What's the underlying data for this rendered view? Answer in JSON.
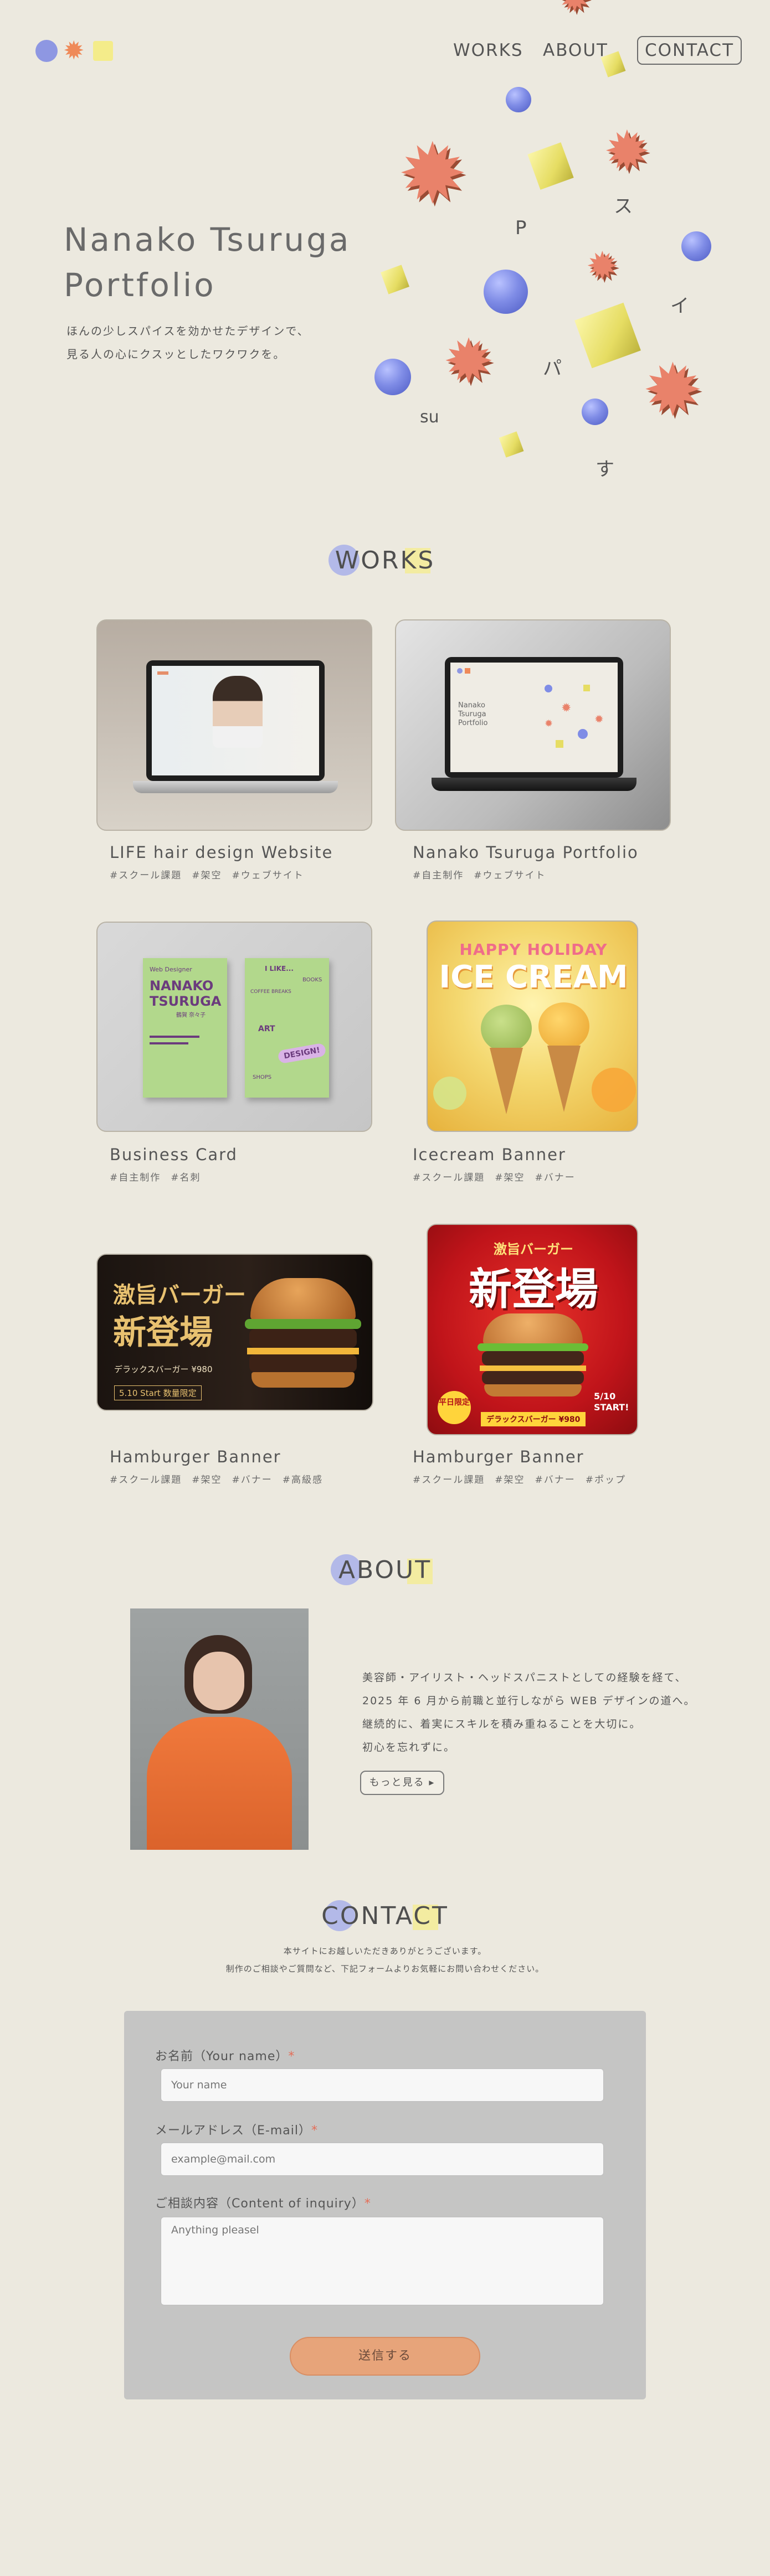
{
  "nav": {
    "works": "WORKS",
    "about": "ABOUT",
    "contact": "CONTACT"
  },
  "hero": {
    "title_line1": "Nanako Tsuruga",
    "title_line2": "Portfolio",
    "sub_line1": "ほんの少しスパイスを効かせたデザインで、",
    "sub_line2": "見る人の心にクスッとしたワクワクを。",
    "floating_letters": [
      "P",
      "ス",
      "イ",
      "パ",
      "su",
      "す"
    ]
  },
  "works": {
    "heading": "WORKS",
    "items": [
      {
        "title": "LIFE hair design Website",
        "tags": [
          "#スクール課題",
          "#架空",
          "#ウェブサイト"
        ]
      },
      {
        "title": "Nanako Tsuruga Portfolio",
        "tags": [
          "#自主制作",
          "#ウェブサイト"
        ]
      },
      {
        "title": "Business Card",
        "tags": [
          "#自主制作",
          "#名刺"
        ]
      },
      {
        "title": "Icecream Banner",
        "tags": [
          "#スクール課題",
          "#架空",
          "#バナー"
        ]
      },
      {
        "title": "Hamburger Banner",
        "tags": [
          "#スクール課題",
          "#架空",
          "#バナー",
          "#高級感"
        ]
      },
      {
        "title": "Hamburger Banner",
        "tags": [
          "#スクール課題",
          "#架空",
          "#バナー",
          "#ポップ"
        ]
      }
    ],
    "thumb_texts": {
      "card_name": "NANAKO TSURUGA",
      "card_kana": "鶴賀 奈々子",
      "card_label": "Web Designer",
      "card_words": [
        "I LIKE...",
        "BOOKS",
        "COFFEE BREAKS",
        "ART",
        "DESIGN!",
        "SHOPS"
      ],
      "ice_line1": "HAPPY HOLIDAY",
      "ice_line2": "ICE CREAM",
      "burger1_big": "激旨バーガー",
      "burger1_new": "新登場",
      "burger1_name": "デラックスバーガー ¥980",
      "burger1_date": "5.10 Start 数量限定",
      "burger2_top": "激旨バーガー",
      "burger2_big": "新登場",
      "burger2_badge": "平日限定",
      "burger2_date": "5/10 START!",
      "burger2_name": "デラックスバーガー ¥980"
    },
    "mock_site_title": "Nanako Tsuruga Portfolio"
  },
  "about": {
    "heading": "ABOUT",
    "lines": [
      "美容師・アイリスト・ヘッドスパニストとしての経験を経て、",
      "2025 年 6 月から前職と並行しながら WEB デザインの道へ。",
      "継続的に、着実にスキルを積み重ねることを大切に。",
      "初心を忘れずに。"
    ],
    "more_label": "もっと見る ▸"
  },
  "contact": {
    "heading": "CONTACT",
    "lead_line1": "本サイトにお越しいただきありがとうございます。",
    "lead_line2": "制作のご相談やご質問など、下記フォームよりお気軽にお問い合わせください。",
    "name_label": "お名前（Your name）",
    "name_placeholder": "Your name",
    "email_label": "メールアドレス（E-mail）",
    "email_placeholder": "example@mail.com",
    "inquiry_label": "ご相談内容（Content of inquiry）",
    "inquiry_placeholder": "Anything pleasel",
    "required_mark": "*",
    "submit_label": "送信する"
  },
  "colors": {
    "background": "#ECE9DF",
    "accent_blue": "#7F8CE6",
    "accent_orange": "#E9826A",
    "accent_yellow": "#F4EC9A",
    "submit": "#E7A47A"
  }
}
